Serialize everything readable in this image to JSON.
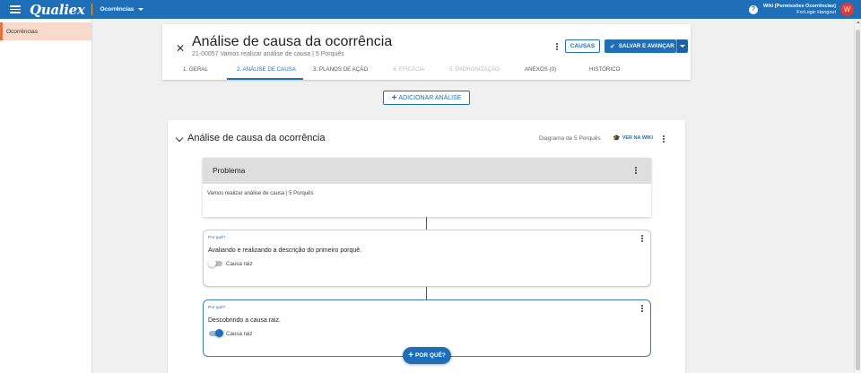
{
  "topbar": {
    "logo": "Qualiex",
    "module": "Ocorrências",
    "help": "?",
    "user_name": "Wiki [Permissões Ocorrências]",
    "user_org": "ForLogic Hangout",
    "avatar_initial": "W",
    "brand_color": "#1f6fb8"
  },
  "sidebar": {
    "items": [
      {
        "label": "Ocorrências",
        "active": true
      }
    ]
  },
  "header": {
    "title": "Análise de causa da ocorrência",
    "subtitle": "21-00057 Vamos realizar análise de causa | 5 Porquês",
    "causas_label": "CAUSAS",
    "save_label": "SALVAR E AVANÇAR",
    "tabs": [
      {
        "label": "1. GERAL",
        "state": "normal"
      },
      {
        "label": "2. ANÁLISE DE CAUSA",
        "state": "active"
      },
      {
        "label": "3. PLANOS DE AÇÃO",
        "state": "normal"
      },
      {
        "label": "4. EFICÁCIA",
        "state": "disabled"
      },
      {
        "label": "5. PADRONIZAÇÃO",
        "state": "disabled"
      },
      {
        "label": "ANEXOS (0)",
        "state": "normal"
      },
      {
        "label": "HISTÓRICO",
        "state": "normal"
      }
    ]
  },
  "add_analysis_label": "ADICIONAR ANÁLISE",
  "analysis": {
    "title": "Análise de causa da ocorrência",
    "diagram": "Diagrama de 5 Porquês",
    "wiki": "VER NA WIKI",
    "problem": {
      "title": "Problema",
      "text": "Vamos realizar análise de causa | 5 Porquês"
    },
    "whys": [
      {
        "label": "Por quê?",
        "text": "Avaliando e realizando a descrição do primeiro porquê.",
        "root_cause_label": "Causa raiz",
        "root_cause": false
      },
      {
        "label": "Por quê?",
        "text": "Descobrindo a causa raiz.",
        "root_cause_label": "Causa raiz",
        "root_cause": true
      }
    ],
    "add_why_label": "POR QUÊ?"
  }
}
